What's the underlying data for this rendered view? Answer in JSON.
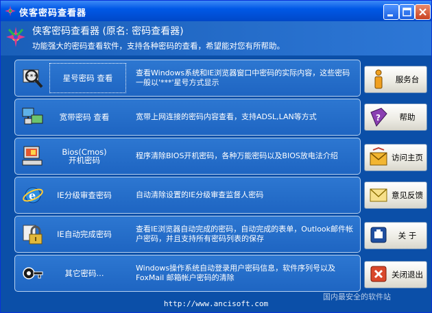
{
  "window": {
    "title": "侠客密码查看器"
  },
  "header": {
    "title": "侠客密码查看器 (原名: 密码查看器)",
    "description": "功能强大的密码查看软件，支持各种密码的查看，希望能对您有所帮助。"
  },
  "items": [
    {
      "label_line1": "星号密码 查看",
      "label_line2": "",
      "icon": "magnifier-asterisk-icon",
      "description": "查看Windows系统和IE浏览器窗口中密码的实际内容，这些密码一般以'***'星号方式显示"
    },
    {
      "label_line1": "宽带密码 查看",
      "label_line2": "",
      "icon": "network-computers-icon",
      "description": "宽带上网连接的密码内容查看，支持ADSL,LAN等方式"
    },
    {
      "label_line1": "Bios(Cmos)",
      "label_line2": "开机密码",
      "icon": "computer-bios-icon",
      "description": "程序清除BIOS开机密码，各种万能密码以及BIOS放电法介绍"
    },
    {
      "label_line1": "IE分级审查密码",
      "label_line2": "",
      "icon": "ie-globe-icon",
      "description": "自动清除设置的IE分级审查监督人密码"
    },
    {
      "label_line1": "IE自动完成密码",
      "label_line2": "",
      "icon": "padlock-icon",
      "description": "查看IE浏览器自动完成的密码，自动完成的表单，Outlook邮件帐户密码，并且支持所有密码列表的保存"
    },
    {
      "label_line1": "其它密码...",
      "label_line2": "",
      "icon": "key-icon",
      "description": "Windows操作系统自动登录用户密码信息，软件序列号以及FoxMail 邮箱帐户密码的清除"
    }
  ],
  "side_buttons": [
    {
      "label": "服务台",
      "icon": "info-icon"
    },
    {
      "label": "帮助",
      "icon": "help-book-icon"
    },
    {
      "label": "访问主页",
      "icon": "home-envelope-icon"
    },
    {
      "label": "意见反馈",
      "icon": "mail-icon"
    },
    {
      "label": "关 于",
      "icon": "about-icon"
    },
    {
      "label": "关闭退出",
      "icon": "close-exit-icon"
    }
  ],
  "footer": {
    "url": "http://www.ancisoft.com"
  },
  "watermark": {
    "text": "国内最安全的软件站"
  },
  "colors": {
    "title_bar": "#0058e6",
    "card_bg": "#2470cc",
    "window_bg": "#0b4fa8",
    "button_face": "#ecebe3"
  }
}
